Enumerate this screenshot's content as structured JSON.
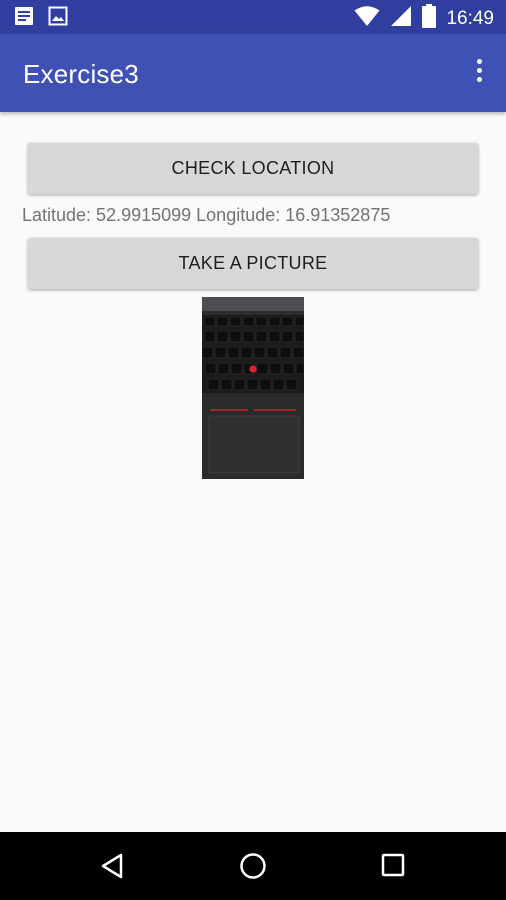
{
  "status_bar": {
    "time": "16:49",
    "icons": [
      "notes-icon",
      "image-icon",
      "wifi-icon",
      "signal-icon",
      "battery-icon"
    ]
  },
  "app_bar": {
    "title": "Exercise3",
    "overflow_icon": "more-vert-icon"
  },
  "main": {
    "check_location_label": "CHECK LOCATION",
    "location_text": "Latitude: 52.9915099 Longitude: 16.91352875",
    "take_picture_label": "TAKE A PICTURE"
  },
  "nav_bar": {
    "icons": [
      "back-icon",
      "home-icon",
      "recents-icon"
    ]
  },
  "colors": {
    "status_bar": "#303f9f",
    "app_bar": "#3f51b5",
    "button": "#d6d7d7",
    "background": "#fafafa",
    "trackpoint": "#e0202a"
  }
}
